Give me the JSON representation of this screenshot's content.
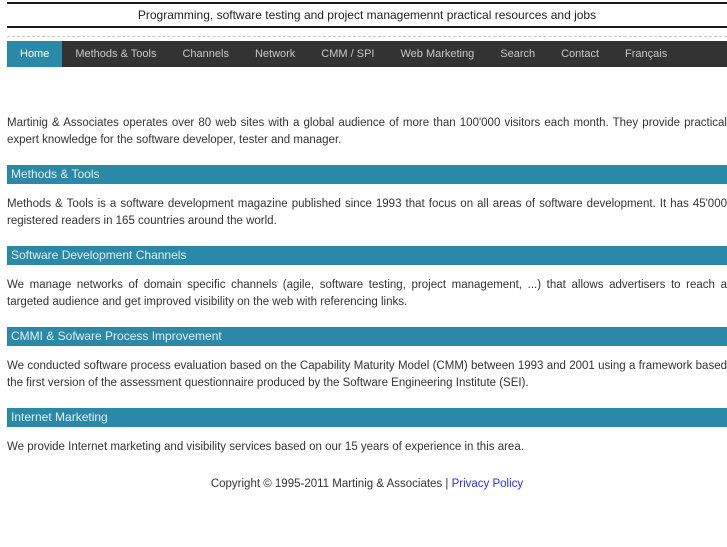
{
  "banner": {
    "title": "Programming, software testing and project managemennt practical resources and jobs"
  },
  "nav": {
    "items": [
      {
        "label": "Home",
        "active": true
      },
      {
        "label": "Methods & Tools",
        "active": false
      },
      {
        "label": "Channels",
        "active": false
      },
      {
        "label": "Network",
        "active": false
      },
      {
        "label": "CMM / SPI",
        "active": false
      },
      {
        "label": "Web Marketing",
        "active": false
      },
      {
        "label": "Search",
        "active": false
      },
      {
        "label": "Contact",
        "active": false
      },
      {
        "label": "Français",
        "active": false
      }
    ]
  },
  "intro": "Martinig & Associates operates over 80 web sites with a global audience of more than 100'000 visitors each month. They provide practical expert knowledge for the software developer, tester and manager.",
  "sections": [
    {
      "heading": "Methods & Tools",
      "body": "Methods & Tools is a software development magazine published since 1993 that focus on all areas of software development. It has 45'000 registered readers in 165 countries around the world."
    },
    {
      "heading": "Software Development Channels",
      "body": "We manage networks of domain specific channels (agile, software testing, project management, ...) that allows advertisers to reach a targeted audience and get improved visibility on the web with referencing links."
    },
    {
      "heading": "CMMI & Sofware Process Improvement",
      "body": "We conducted software process evaluation based on the Capability Maturity Model (CMM) between 1993 and 2001 using a framework based the first version of the assessment questionnaire produced by the Software Engineering Institute (SEI)."
    },
    {
      "heading": "Internet Marketing",
      "body": "We provide Internet marketing and visibility services based on our 15 years of experience in this area."
    }
  ],
  "footer": {
    "copyright": "Copyright © 1995-2011 Martinig & Associates |",
    "privacy_link": "Privacy Policy"
  },
  "colors": {
    "accent_teal": "#2b89a8",
    "nav_background": "#333333",
    "link_blue": "#2b2bff",
    "body_text": "#333333"
  }
}
